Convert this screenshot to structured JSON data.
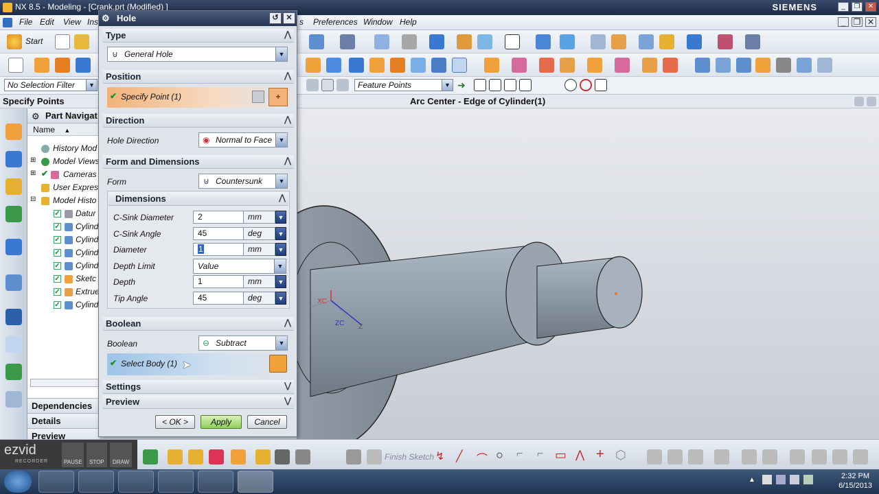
{
  "window": {
    "title": "NX 8.5 - Modeling - [Crank.prt (Modified) ]",
    "brand": "SIEMENS"
  },
  "menu": [
    "File",
    "Edit",
    "View",
    "Ins",
    "s",
    "Preferences",
    "Window",
    "Help"
  ],
  "toolbar": {
    "start_label": "Start"
  },
  "selection": {
    "filter": "No Selection Filter",
    "snap_mode": "Feature Points"
  },
  "cue": {
    "left": "Specify Points",
    "center": "Arc Center - Edge of Cylinder(1)"
  },
  "navigator": {
    "title": "Part Navigat",
    "column_name": "Name",
    "rows": [
      {
        "label": "History Mod",
        "icon": "clock-icon"
      },
      {
        "label": "Model Views",
        "icon": "globe-icon"
      },
      {
        "label": "Cameras",
        "icon": "camera-icon"
      },
      {
        "label": "User Expres",
        "icon": "folder-icon"
      },
      {
        "label": "Model Histo",
        "icon": "folder-icon"
      },
      {
        "label": "Datur",
        "icon": "datum-icon"
      },
      {
        "label": "Cylind",
        "icon": "cylinder-icon"
      },
      {
        "label": "Cylind",
        "icon": "cylinder-icon"
      },
      {
        "label": "Cylind",
        "icon": "cylinder-icon"
      },
      {
        "label": "Cylind",
        "icon": "cylinder-icon"
      },
      {
        "label": "Sketc",
        "icon": "sketch-icon"
      },
      {
        "label": "Extrue",
        "icon": "extrude-icon"
      },
      {
        "label": "Cylind",
        "icon": "cylinder-icon"
      }
    ],
    "dependencies": "Dependencies",
    "details": "Details",
    "preview": "Preview"
  },
  "dialog": {
    "title": "Hole",
    "type": {
      "header": "Type",
      "value": "General Hole"
    },
    "position": {
      "header": "Position",
      "specify_point": "Specify Point (1)"
    },
    "direction": {
      "header": "Direction",
      "label": "Hole Direction",
      "value": "Normal to Face"
    },
    "form": {
      "header": "Form and Dimensions",
      "label": "Form",
      "value": "Countersunk"
    },
    "dimensions": {
      "header": "Dimensions",
      "csink_diameter": {
        "label": "C-Sink Diameter",
        "value": "2",
        "unit": "mm"
      },
      "csink_angle": {
        "label": "C-Sink Angle",
        "value": "45",
        "unit": "deg"
      },
      "diameter": {
        "label": "Diameter",
        "value": "1",
        "unit": "mm"
      },
      "depth_limit": {
        "label": "Depth Limit",
        "value": "Value"
      },
      "depth": {
        "label": "Depth",
        "value": "1",
        "unit": "mm"
      },
      "tip_angle": {
        "label": "Tip Angle",
        "value": "45",
        "unit": "deg"
      }
    },
    "boolean": {
      "header": "Boolean",
      "label": "Boolean",
      "value": "Subtract",
      "select_body": "Select Body (1)"
    },
    "settings": "Settings",
    "preview": "Preview",
    "buttons": {
      "ok": "< OK >",
      "apply": "Apply",
      "cancel": "Cancel"
    }
  },
  "recorder": {
    "brand": "ezvid",
    "sub": "RECORDER",
    "pause": "PAUSE",
    "stop": "STOP",
    "draw": "DRAW"
  },
  "sketch_toolbar": {
    "finish": "Finish Sketch"
  },
  "axes": {
    "xc": "XC",
    "zc": "ZC",
    "z": "Z"
  },
  "taskbar": {
    "time": "2:32 PM",
    "date": "6/15/2013"
  }
}
